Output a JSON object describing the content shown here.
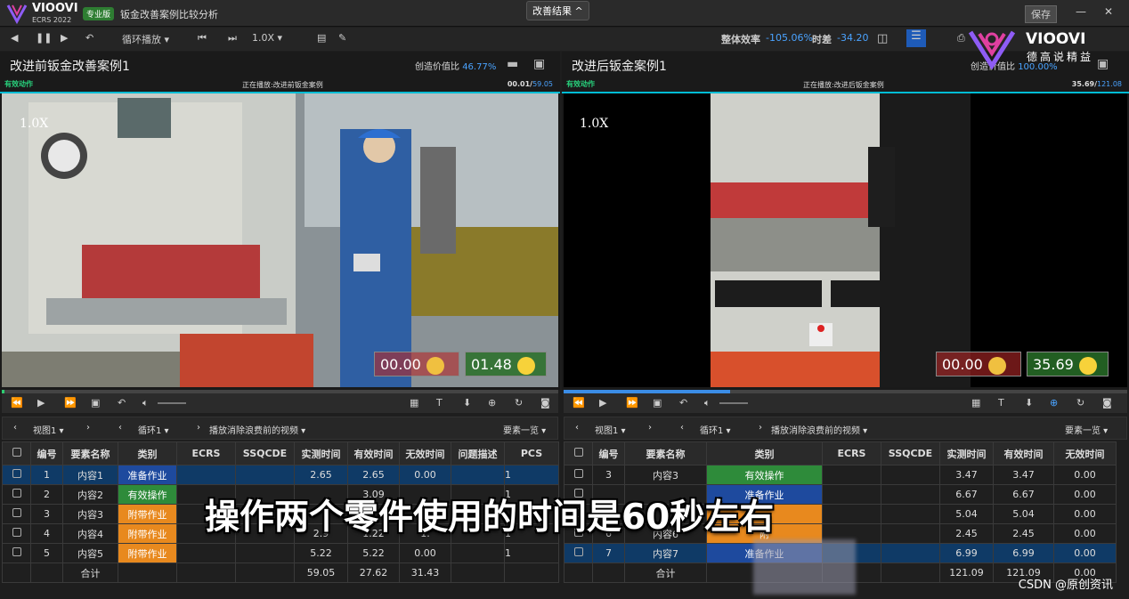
{
  "app": {
    "brand": "VIOOVI",
    "brand_sub": "ECRS 2022",
    "edition_badge": "专业版",
    "doc_title": "钣金改善案例比较分析",
    "center_tab": "改善结果 ^",
    "save": "保存"
  },
  "toolbar": {
    "loop": "循环播放",
    "speed": "1.0X",
    "efficiency_label": "整体效率",
    "efficiency_value": "-105.06%",
    "time_diff_label": "时差",
    "time_diff_value": "-34.20"
  },
  "left_pane": {
    "title": "改进前钣金改善案例1",
    "ratio_label": "创造价值比",
    "ratio_value": "46.77%",
    "effective_label": "有效动作",
    "now_playing": "正在播放:改进前钣金案例",
    "time_current": "00.01/",
    "time_total": "59.05",
    "speed_overlay": "1.0X",
    "timer_waste": "00.00",
    "timer_value": "01.48",
    "progress": 0.0
  },
  "right_pane": {
    "title": "改进后钣金案例1",
    "ratio_label": "创造价值比",
    "ratio_value": "100.00%",
    "effective_label": "有效动作",
    "now_playing": "正在播放:改进后钣金案例",
    "time_current": "35.69/",
    "time_total": "121.08",
    "speed_overlay": "1.0X",
    "timer_waste": "00.00",
    "timer_value": "35.69",
    "progress": 0.295
  },
  "left_nav": {
    "view": "视图1",
    "loop": "循环1",
    "play_mode": "播放消除浪费前的视频",
    "list": "要素一览"
  },
  "right_nav": {
    "view": "视图1",
    "loop": "循环1",
    "play_mode": "播放消除浪费前的视频",
    "list": "要素一览"
  },
  "left_table": {
    "headers": [
      "编号",
      "要素名称",
      "类别",
      "ECRS",
      "SSQCDE",
      "实测时间",
      "有效时间",
      "无效时间",
      "问题描述",
      "PCS"
    ],
    "rows": [
      {
        "no": "1",
        "name": "内容1",
        "cat": "准备作业",
        "cat_color": "blue",
        "measured": "2.65",
        "effective": "2.65",
        "invalid": "0.00",
        "pcs": "1",
        "selected": true
      },
      {
        "no": "2",
        "name": "内容2",
        "cat": "有效操作",
        "cat_color": "green",
        "measured": "",
        "effective": "3.09",
        "invalid": "",
        "pcs": "1",
        "selected": false
      },
      {
        "no": "3",
        "name": "内容3",
        "cat": "附带作业",
        "cat_color": "orange",
        "measured": "",
        "effective": "",
        "invalid": "",
        "pcs": "",
        "selected": false
      },
      {
        "no": "4",
        "name": "内容4",
        "cat": "附带作业",
        "cat_color": "orange",
        "measured": "2.9",
        "effective": "1.22",
        "invalid": "1.",
        "pcs": "1",
        "selected": false
      },
      {
        "no": "5",
        "name": "内容5",
        "cat": "附带作业",
        "cat_color": "orange",
        "measured": "5.22",
        "effective": "5.22",
        "invalid": "0.00",
        "pcs": "1",
        "selected": false
      }
    ],
    "total_label": "合计",
    "total_measured": "59.05",
    "total_effective": "27.62",
    "total_invalid": "31.43"
  },
  "right_table": {
    "headers": [
      "编号",
      "要素名称",
      "类别",
      "ECRS",
      "SSQCDE",
      "实测时间",
      "有效时间",
      "无效时间"
    ],
    "rows": [
      {
        "no": "3",
        "name": "内容3",
        "cat": "有效操作",
        "cat_color": "green",
        "measured": "3.47",
        "effective": "3.47",
        "invalid": "0.00",
        "selected": false
      },
      {
        "no": "",
        "name": "",
        "cat": "准备作业",
        "cat_color": "blue",
        "measured": "6.67",
        "effective": "6.67",
        "invalid": "0.00",
        "selected": false
      },
      {
        "no": "",
        "name": "",
        "cat": "",
        "cat_color": "orange",
        "measured": "5.04",
        "effective": "5.04",
        "invalid": "0.00",
        "selected": false
      },
      {
        "no": "6",
        "name": "内容6",
        "cat": "附",
        "cat_color": "orange",
        "measured": "2.45",
        "effective": "2.45",
        "invalid": "0.00",
        "selected": false
      },
      {
        "no": "7",
        "name": "内容7",
        "cat": "准备作业",
        "cat_color": "blue",
        "measured": "6.99",
        "effective": "6.99",
        "invalid": "0.00",
        "selected": true
      }
    ],
    "total_label": "合计",
    "total_measured": "121.09",
    "total_effective": "121.09",
    "total_invalid": "0.00"
  },
  "overlay": {
    "subtitle": "操作两个零件使用的时间是60秒左右",
    "watermark": "CSDN @原创资讯",
    "brand_wm": "VIOOVI",
    "brand_wm_sub": "德高说精益"
  }
}
